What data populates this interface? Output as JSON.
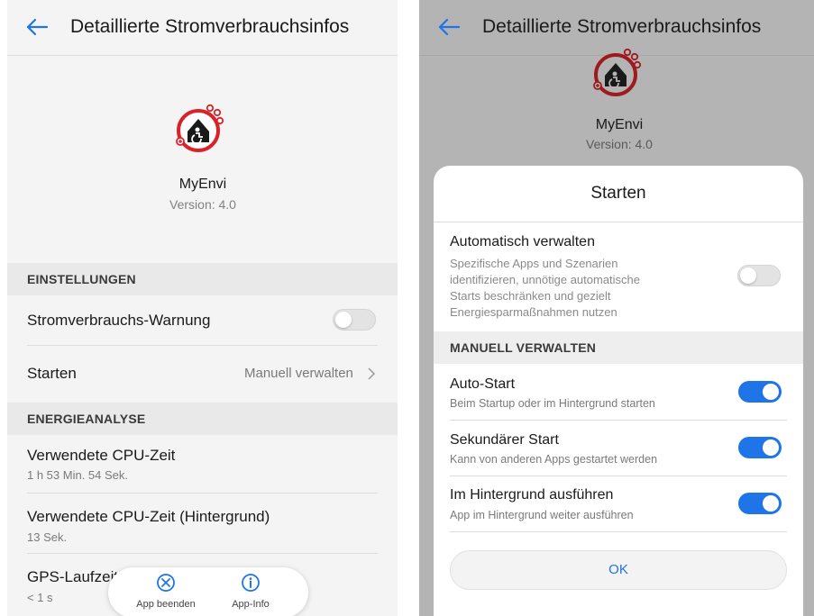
{
  "left": {
    "title": "Detaillierte Stromverbrauchsinfos",
    "app": {
      "name": "MyEnvi",
      "version": "Version: 4.0"
    },
    "sections": {
      "settings": "EINSTELLUNGEN",
      "energy": "ENERGIEANALYSE"
    },
    "settings": {
      "warning_label": "Stromverbrauchs-Warnung",
      "warning_enabled": false,
      "start_label": "Starten",
      "start_value": "Manuell verwalten"
    },
    "energy": {
      "cpu_label": "Verwendete CPU-Zeit",
      "cpu_value": "1 h 53 Min. 54 Sek.",
      "cpu_bg_label": "Verwendete CPU-Zeit (Hintergrund)",
      "cpu_bg_value": "13 Sek.",
      "gps_label": "GPS-Laufzeit",
      "gps_value": "< 1 s"
    },
    "bottom_bar": {
      "stop_label": "App beenden",
      "info_label": "App-Info"
    }
  },
  "right": {
    "title": "Detaillierte Stromverbrauchsinfos",
    "app": {
      "name": "MyEnvi",
      "version": "Version: 4.0"
    },
    "dialog": {
      "title": "Starten",
      "auto_manage": {
        "label": "Automatisch verwalten",
        "desc_lines": [
          "Spezifische Apps und Szenarien",
          "identifizieren, unnötige automatische",
          "Starts beschränken und gezielt",
          "Energiesparmaßnahmen nutzen"
        ],
        "enabled": false
      },
      "manual_header": "MANUELL VERWALTEN",
      "options": [
        {
          "label": "Auto-Start",
          "desc": "Beim Startup oder im Hintergrund starten",
          "enabled": true
        },
        {
          "label": "Sekundärer Start",
          "desc": "Kann von anderen Apps gestartet werden",
          "enabled": true
        },
        {
          "label": "Im Hintergrund ausführen",
          "desc": "App im Hintergrund weiter ausführen",
          "enabled": true
        }
      ],
      "ok_label": "OK"
    }
  },
  "colors": {
    "accent": "#1f74e8",
    "icon_red": "#d8232a",
    "scrim": "#b4b4b4"
  }
}
